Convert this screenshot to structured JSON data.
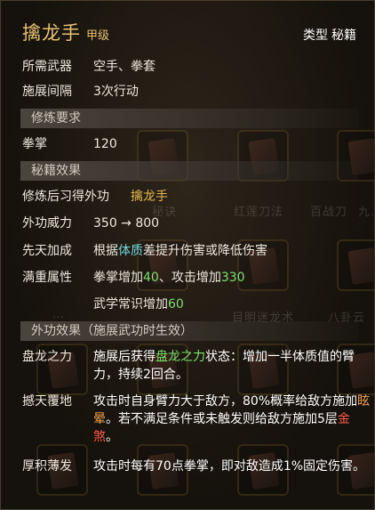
{
  "header": {
    "title": "擒龙手",
    "grade": "甲级",
    "type_label": "类型",
    "type_value": "秘籍"
  },
  "info": {
    "weapon_label": "所需武器",
    "weapon_value": "空手、拳套",
    "interval_label": "施展间隔",
    "interval_value": "3次行动"
  },
  "cultivation": {
    "header": "修炼要求",
    "req_label": "拳掌",
    "req_value": "120"
  },
  "effects": {
    "header": "秘籍效果",
    "learn_label": "修炼后习得外功",
    "learn_value": "擒龙手",
    "power_label": "外功威力",
    "power_value": "350 → 800",
    "innate_label": "先天加成",
    "innate_pre": "根据",
    "innate_attr": "体质",
    "innate_post": "差提升伤害或降低伤害",
    "full_label": "满重属性",
    "full_line1_a": "拳掌增加",
    "full_line1_b": "40",
    "full_line1_c": "、攻击增加",
    "full_line1_d": "330",
    "full_line2_a": "武学常识增加",
    "full_line2_b": "60"
  },
  "skill_effects": {
    "header": "外功效果（施展武功时生效）",
    "e1_label": "盘龙之力",
    "e1_a": "施展后获得",
    "e1_b": "盘龙之力",
    "e1_c": "状态：增加一半体质值的臂力，持续2回合。",
    "e2_label": "撼天覆地",
    "e2_a": "攻击时自身臂力大于敌方，80%概率给敌方施加",
    "e2_b": "眩晕",
    "e2_c": "。若不满足条件或未触发则给敌方施加5层",
    "e2_d": "金煞",
    "e2_e": "。",
    "e3_label": "厚积薄发",
    "e3_value": "攻击时每有70点拳掌，即对敌造成1%固定伤害。"
  },
  "background": {
    "labels": [
      "秘诀",
      "红莲刀法",
      "百战刀",
      "九…",
      "目明迷龙术",
      "八卦云",
      "…"
    ]
  },
  "colors": {
    "title": "#e8c272",
    "highlight_gold": "#e3b84e",
    "highlight_cyan": "#6fd4df",
    "highlight_green": "#7de06a",
    "highlight_orange": "#f0a04a",
    "highlight_red": "#ff5a4a"
  }
}
